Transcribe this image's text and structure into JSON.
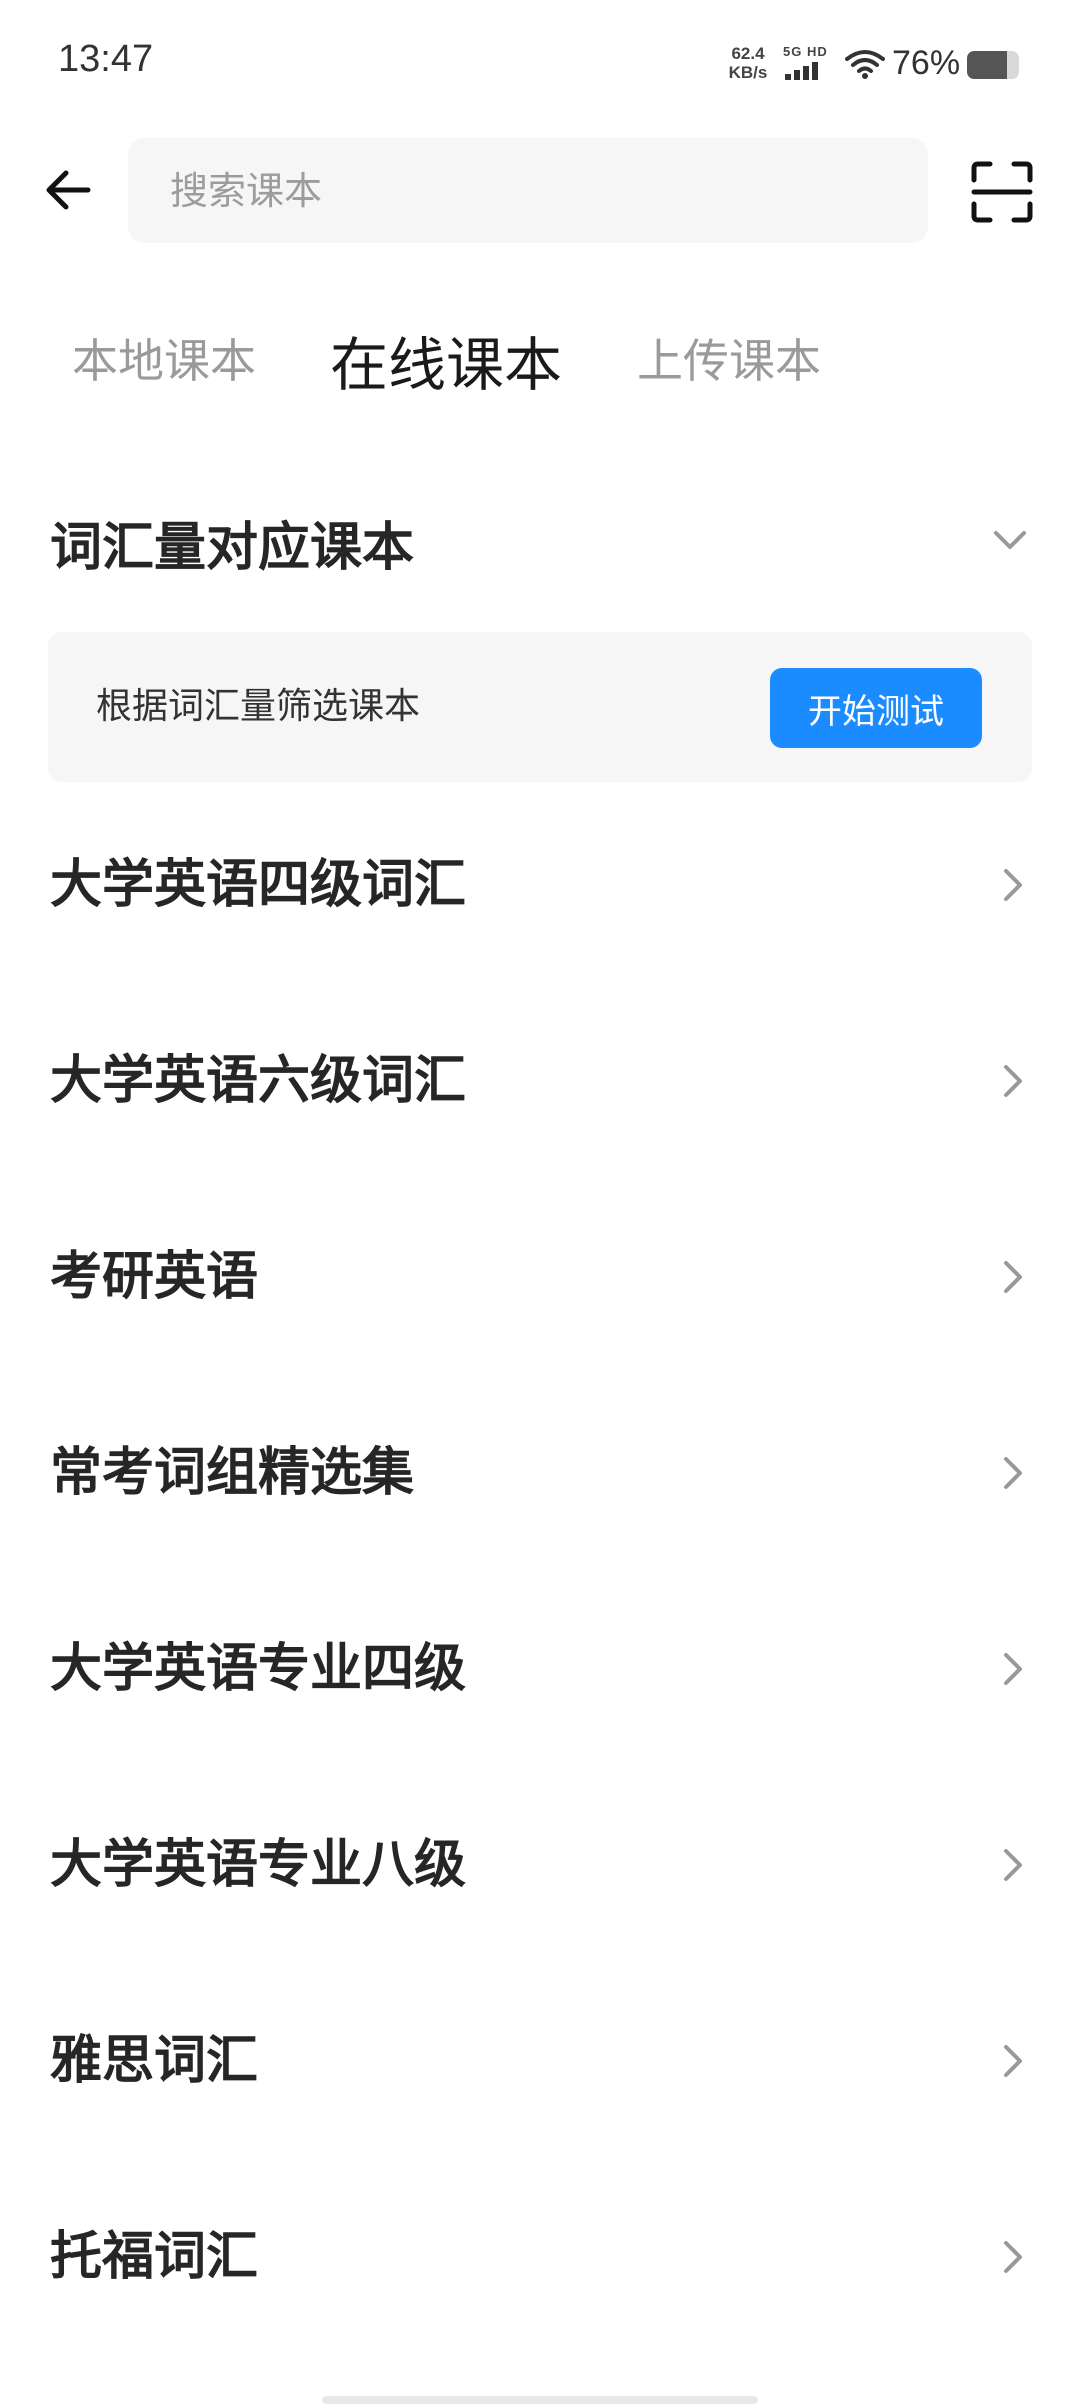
{
  "status_bar": {
    "time": "13:47",
    "net_speed_value": "62.4",
    "net_speed_unit": "KB/s",
    "signal_label": "5G HD",
    "battery_percent": "76%",
    "battery_level": 0.76
  },
  "header": {
    "search_placeholder": "搜索课本",
    "back_icon": "arrow-left-icon",
    "scan_icon": "scan-icon"
  },
  "tabs": [
    {
      "label": "本地课本",
      "active": false
    },
    {
      "label": "在线课本",
      "active": true
    },
    {
      "label": "上传课本",
      "active": false
    }
  ],
  "section": {
    "title": "词汇量对应课本",
    "filter_text": "根据词汇量筛选课本",
    "filter_button": "开始测试"
  },
  "books": [
    {
      "label": "大学英语四级词汇"
    },
    {
      "label": "大学英语六级词汇"
    },
    {
      "label": "考研英语"
    },
    {
      "label": "常考词组精选集"
    },
    {
      "label": "大学英语专业四级"
    },
    {
      "label": "大学英语专业八级"
    },
    {
      "label": "雅思词汇"
    },
    {
      "label": "托福词汇"
    }
  ],
  "colors": {
    "accent": "#1a8cff",
    "card_bg": "#f6f6f6",
    "text_primary": "#262626",
    "text_inactive": "#9a9a9a"
  }
}
